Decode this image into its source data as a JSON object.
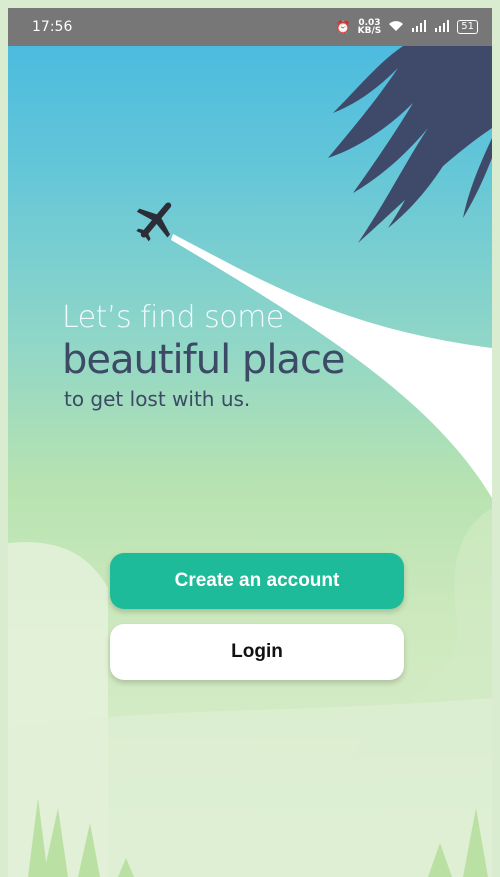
{
  "status_bar": {
    "time": "17:56",
    "alarm_icon": "alarm-clock-icon",
    "network_speed": "0.03",
    "network_unit": "KB/S",
    "wifi_icon": "wifi-icon",
    "signal_icon": "signal-bars-icon",
    "battery": "51"
  },
  "tagline": {
    "line1": "Let’s find some",
    "line2": "beautiful place",
    "line3": "to get lost with us."
  },
  "buttons": {
    "create_account": "Create an account",
    "login": "Login"
  },
  "colors": {
    "primary": "#1dbb99",
    "heading": "#3c4a66",
    "sky_top": "#45b8e1",
    "palm": "#3f4a6b"
  },
  "illustration": {
    "airplane_icon": "airplane-icon",
    "palm_leaves": "palm-leaf-icon",
    "grass": "grass-icon"
  }
}
